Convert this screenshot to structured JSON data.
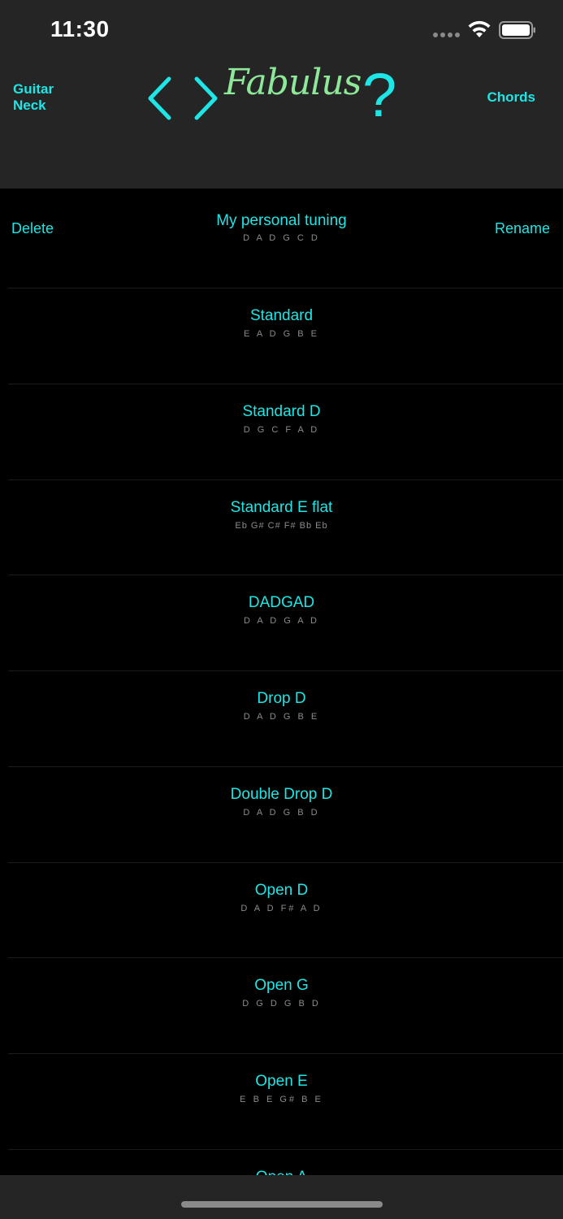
{
  "status": {
    "time": "11:30"
  },
  "nav": {
    "left_label": "Guitar Neck",
    "logo": "Fabulus",
    "help": "?",
    "right_label": "Chords"
  },
  "list": {
    "delete_label": "Delete",
    "rename_label": "Rename",
    "tunings": [
      {
        "name": "My personal tuning",
        "notes": "D A D G C D"
      },
      {
        "name": "Standard",
        "notes": "E A D G B E"
      },
      {
        "name": "Standard D",
        "notes": "D G C F A D"
      },
      {
        "name": "Standard E flat",
        "notes": "Eb G# C# F# Bb Eb"
      },
      {
        "name": "DADGAD",
        "notes": "D A D G A D"
      },
      {
        "name": "Drop D",
        "notes": "D A D G B E"
      },
      {
        "name": "Double Drop D",
        "notes": "D A D G B D"
      },
      {
        "name": "Open D",
        "notes": "D A D F# A D"
      },
      {
        "name": "Open G",
        "notes": "D G D G B D"
      },
      {
        "name": "Open E",
        "notes": "E B E G# B E"
      },
      {
        "name": "Open A",
        "notes": ""
      }
    ]
  },
  "colors": {
    "accent": "#1ee6e6",
    "logo": "#8ee89a",
    "bar_background": "#252525",
    "background": "#000000"
  }
}
